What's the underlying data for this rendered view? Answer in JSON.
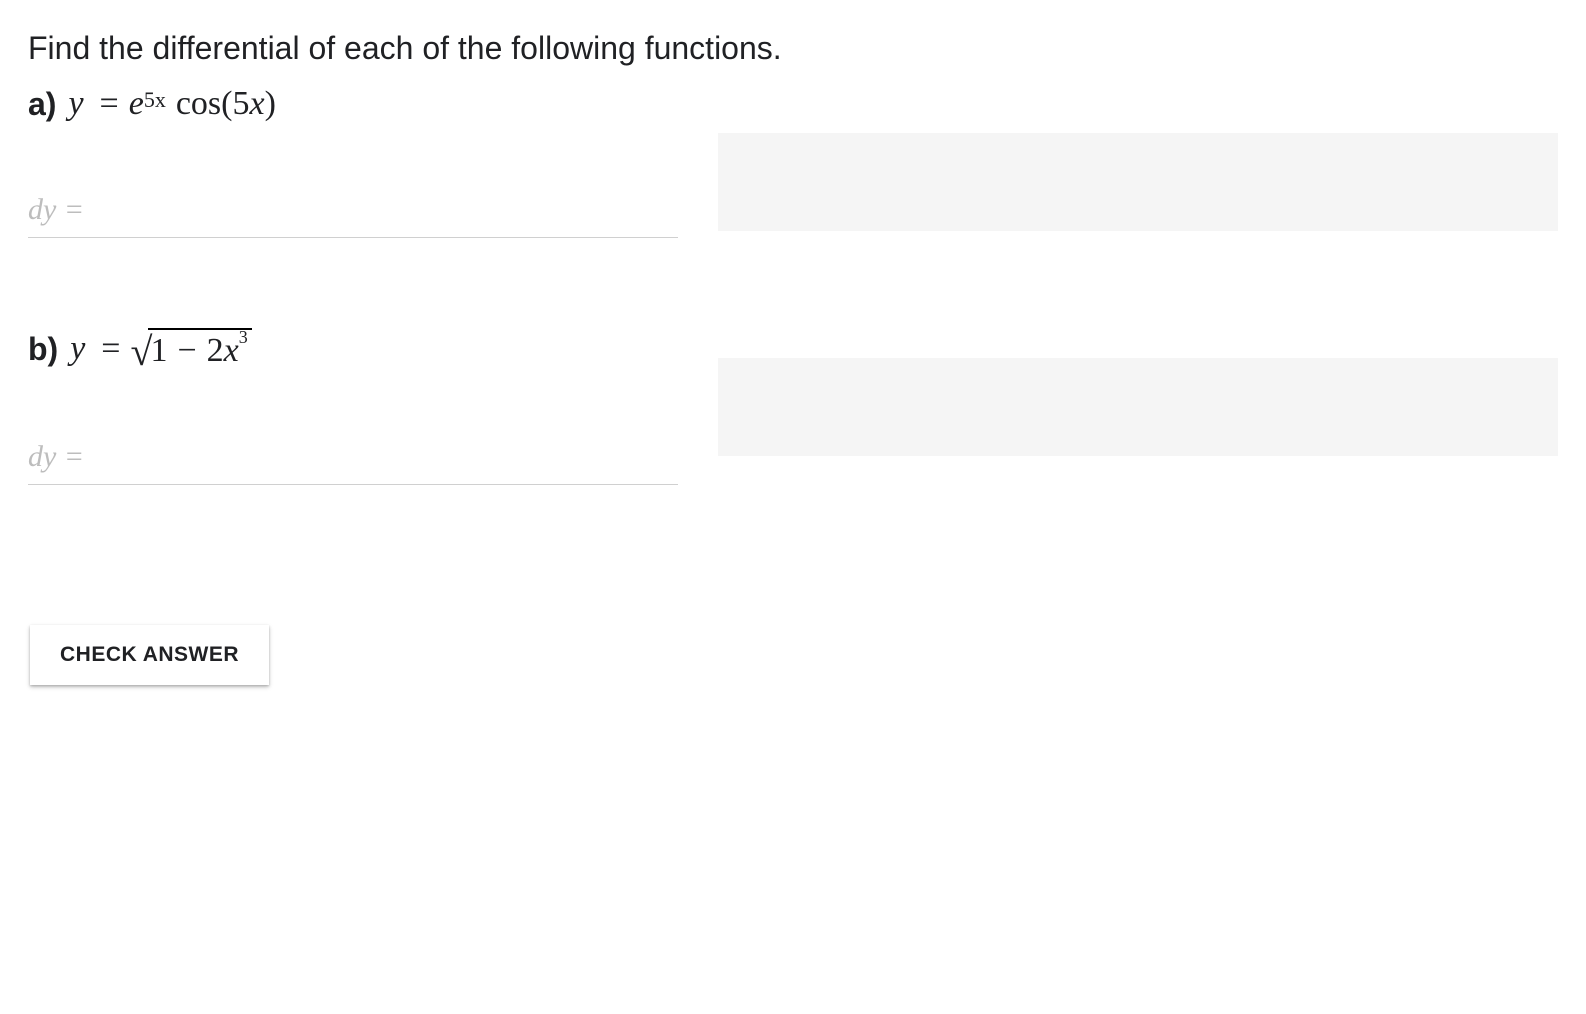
{
  "title": "Find the differential of each of the following functions.",
  "parts": {
    "a": {
      "label": "a)",
      "var": "y",
      "equals": "=",
      "base_e": "e",
      "exp_5x": "5x",
      "cos": "cos",
      "cos_arg_open": "(",
      "cos_arg_5x": "5x",
      "cos_arg_close": ")",
      "input_placeholder": "dy ="
    },
    "b": {
      "label": "b)",
      "var": "y",
      "equals": "=",
      "sqrt_inner_1": "1",
      "sqrt_inner_minus": "−",
      "sqrt_inner_2x": "2x",
      "sqrt_inner_exp": "3",
      "input_placeholder": "dy ="
    }
  },
  "button": {
    "check_label": "CHECK ANSWER"
  }
}
